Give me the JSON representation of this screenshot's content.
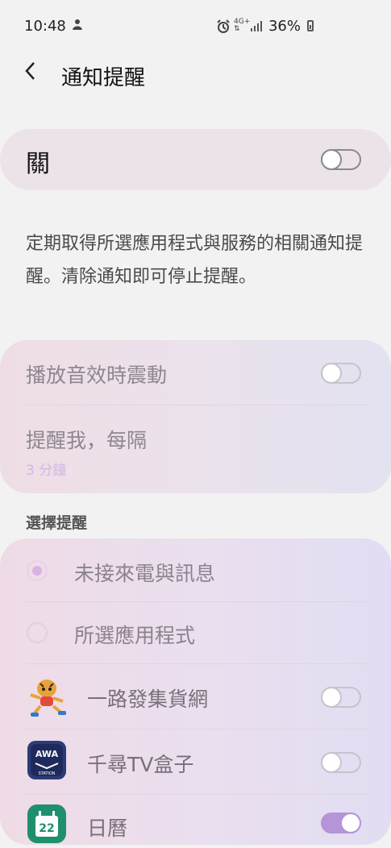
{
  "status_bar": {
    "time": "10:48",
    "network": "4G+",
    "battery": "36%",
    "icons": [
      "assistant-icon",
      "alarm-icon",
      "network-icon",
      "signal-icon",
      "battery-icon"
    ]
  },
  "header": {
    "back_icon": "back-arrow-icon",
    "title": "通知提醒"
  },
  "master": {
    "label": "關",
    "enabled": false
  },
  "description": "定期取得所選應用程式與服務的相關通知提醒。清除通知即可停止提醒。",
  "settings": {
    "vibrate_label": "播放音效時震動",
    "vibrate_enabled": false,
    "interval_label": "提醒我，每隔",
    "interval_value": "3 分鐘"
  },
  "choose_section": {
    "title": "選擇提醒",
    "options": [
      {
        "label": "未接來電與訊息",
        "selected": true
      },
      {
        "label": "所選應用程式",
        "selected": false
      }
    ]
  },
  "apps": [
    {
      "name": "一路發集貨網",
      "icon": "tiger-mascot-icon",
      "enabled": false
    },
    {
      "name": "千尋TV盒子",
      "icon": "awa-station-icon",
      "icon_text": "AWA",
      "icon_subtext": "STATION",
      "enabled": false
    },
    {
      "name": "日曆",
      "icon": "calendar-icon",
      "icon_text": "22",
      "enabled": true
    }
  ],
  "colors": {
    "accent": "#b594d8",
    "background": "#f2f2f2",
    "master_card": "#ece3ea"
  }
}
